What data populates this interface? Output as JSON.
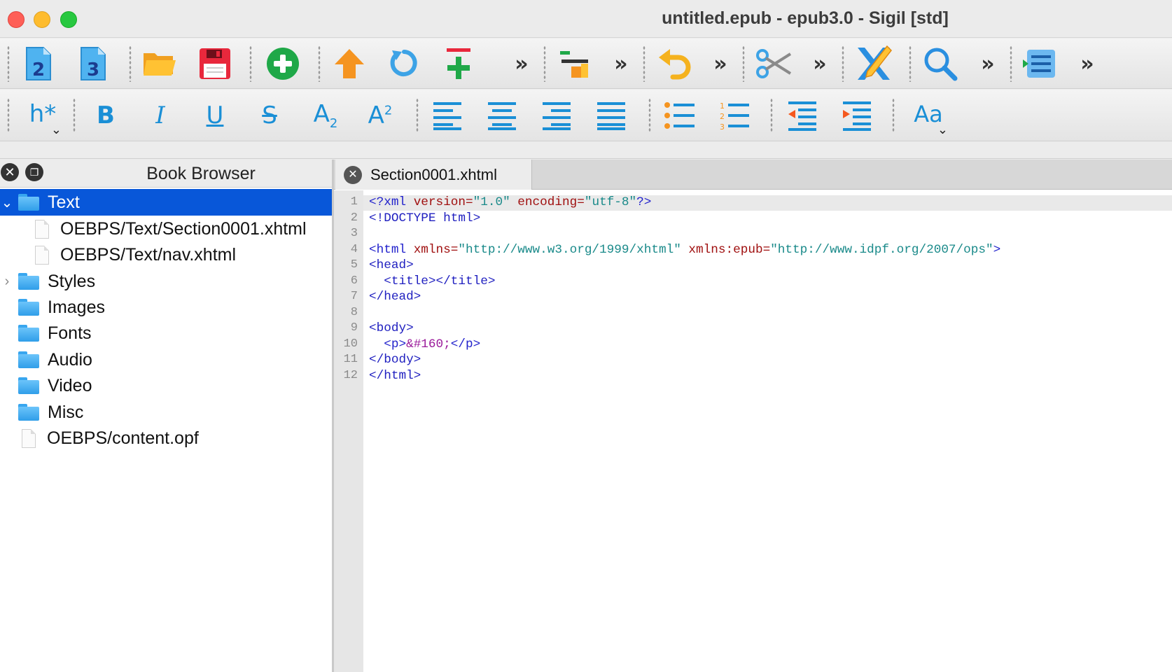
{
  "window": {
    "title": "untitled.epub - epub3.0 - Sigil [std]"
  },
  "toolbar_main": {
    "buttons": [
      {
        "name": "add-html-2",
        "glyph": "2"
      },
      {
        "name": "add-html-3",
        "glyph": "3"
      }
    ],
    "more_glyph": "»"
  },
  "toolbar_format": {
    "heading_label": "h*",
    "bold": "B",
    "italic": "I",
    "underline": "U",
    "strike": "S",
    "subscript_base": "A",
    "subscript_mark": "2",
    "superscript_base": "A",
    "superscript_mark": "2",
    "case_label": "Aa"
  },
  "book_browser": {
    "title": "Book Browser",
    "items": [
      {
        "label": "Text",
        "type": "folder",
        "expanded": true,
        "selected": true
      },
      {
        "label": "OEBPS/Text/Section0001.xhtml",
        "type": "file"
      },
      {
        "label": "OEBPS/Text/nav.xhtml",
        "type": "file"
      },
      {
        "label": "Styles",
        "type": "folder",
        "collapsed": true
      },
      {
        "label": "Images",
        "type": "folder"
      },
      {
        "label": "Fonts",
        "type": "folder"
      },
      {
        "label": "Audio",
        "type": "folder"
      },
      {
        "label": "Video",
        "type": "folder"
      },
      {
        "label": "Misc",
        "type": "folder"
      },
      {
        "label": "OEBPS/content.opf",
        "type": "file"
      }
    ]
  },
  "editor": {
    "tab_label": "Section0001.xhtml",
    "line_numbers": [
      "1",
      "2",
      "3",
      "4",
      "5",
      "6",
      "7",
      "8",
      "9",
      "10",
      "11",
      "12"
    ],
    "code": {
      "l1": {
        "open": "<?xml ",
        "a1": "version=",
        "v1": "\"1.0\"",
        "a2": " encoding=",
        "v2": "\"utf-8\"",
        "close": "?>"
      },
      "l2": "<!DOCTYPE html>",
      "l4": {
        "open": "<html ",
        "a1": "xmlns=",
        "v1": "\"http://www.w3.org/1999/xhtml\"",
        "a2": " xmlns:epub=",
        "v2": "\"http://www.idpf.org/2007/ops\"",
        "close": ">"
      },
      "l5": "<head>",
      "l6": "  <title></title>",
      "l7": "</head>",
      "l9": "<body>",
      "l10": {
        "open": "  <p>",
        "entity": "&#160;",
        "close": "</p>"
      },
      "l11": "</body>",
      "l12": "</html>"
    }
  },
  "colors": {
    "accent": "#1a8fd6",
    "selection": "#0857d9",
    "tag": "#2222cc",
    "attribute": "#a01010",
    "value": "#1a8a8a"
  }
}
